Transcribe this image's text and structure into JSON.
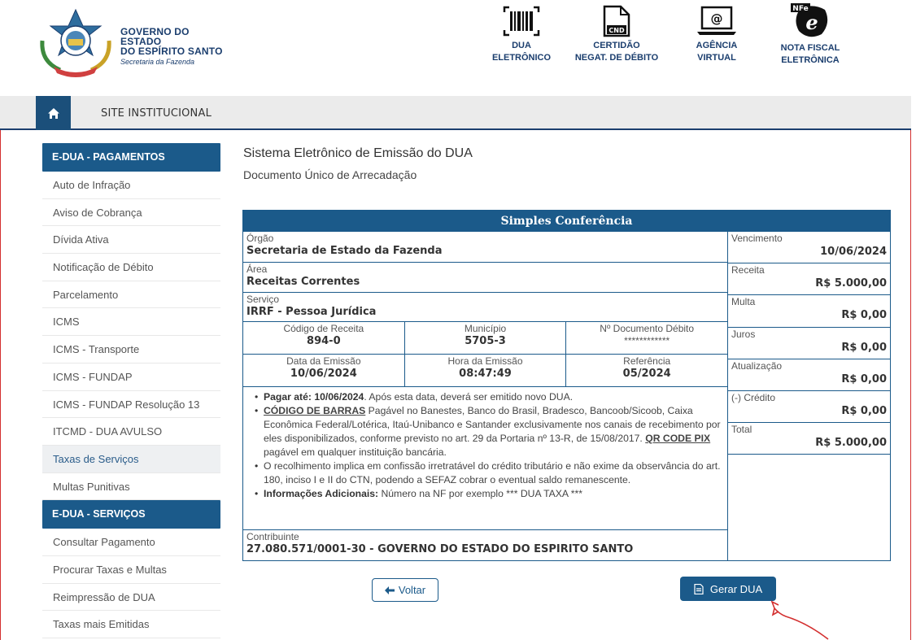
{
  "header": {
    "org_line1": "GOVERNO DO ESTADO",
    "org_line2": "DO ESPÍRITO SANTO",
    "org_line3": "Secretaria da Fazenda",
    "icons": [
      {
        "name": "barcode-icon",
        "line1": "DUA",
        "line2": "ELETRÔNICO"
      },
      {
        "name": "document-icon",
        "badge": "CND",
        "line1": "CERTIDÃO",
        "line2": "NEGAT. DE DÉBITO"
      },
      {
        "name": "laptop-at-icon",
        "line1": "AGÊNCIA",
        "line2": "VIRTUAL"
      },
      {
        "name": "nfe-icon",
        "badge": "NFe",
        "line1": "NOTA FISCAL",
        "line2": "ELETRÔNICA"
      }
    ]
  },
  "nav": {
    "home_icon": "home-icon",
    "link": "SITE INSTITUCIONAL"
  },
  "sidebar": {
    "section1": "E-DUA - PAGAMENTOS",
    "items1": [
      "Auto de Infração",
      "Aviso de Cobrança",
      "Dívida Ativa",
      "Notificação de Débito",
      "Parcelamento",
      "ICMS",
      "ICMS - Transporte",
      "ICMS - FUNDAP",
      "ICMS - FUNDAP Resolução 13",
      "ITCMD - DUA AVULSO",
      "Taxas de Serviços",
      "Multas Punitivas"
    ],
    "active_item": "Taxas de Serviços",
    "section2": "E-DUA - SERVIÇOS",
    "items2": [
      "Consultar Pagamento",
      "Procurar Taxas e Multas",
      "Reimpressão de DUA",
      "Taxas mais Emitidas"
    ]
  },
  "main": {
    "title": "Sistema Eletrônico de Emissão do DUA",
    "subtitle": "Documento Único de Arrecadação"
  },
  "conferencia": {
    "heading": "Simples Conferência",
    "orgao_label": "Órgão",
    "orgao_value": "Secretaria de Estado da Fazenda",
    "area_label": "Área",
    "area_value": "Receitas Correntes",
    "servico_label": "Serviço",
    "servico_value": "IRRF - Pessoa Jurídica",
    "codigo_label": "Código de Receita",
    "codigo_value": "894-0",
    "municipio_label": "Município",
    "municipio_value": "5705-3",
    "ndoc_label": "Nº Documento Débito",
    "ndoc_value": "************",
    "emissao_label": "Data da Emissão",
    "emissao_value": "10/06/2024",
    "hora_label": "Hora da Emissão",
    "hora_value": "08:47:49",
    "referencia_label": "Referência",
    "referencia_value": "05/2024",
    "note1_bold": "Pagar até: 10/06/2024",
    "note1_rest": ". Após esta data, deverá ser emitido novo DUA.",
    "note2_link": "CÓDIGO DE BARRAS",
    "note2_text": " Pagável no Banestes, Banco do Brasil, Bradesco, Bancoob/Sicoob, Caixa Econômica Federal/Lotérica, Itaú-Unibanco e Santander exclusivamente nos canais de recebimento por eles disponibilizados, conforme previsto no art. 29 da Portaria nº 13-R, de 15/08/2017. ",
    "note2_link2": "QR CODE PIX",
    "note2_text2": " pagável em qualquer instituição bancária.",
    "note3": "O recolhimento implica em confissão irretratável do crédito tributário e não exime da observância do art. 180, inciso I e II do CTN, podendo a SEFAZ cobrar o eventual saldo remanescente.",
    "note4_bold": "Informações Adicionais:",
    "note4_text": " Número na NF por exemplo *** DUA TAXA ***",
    "contribuinte_label": "Contribuinte",
    "contribuinte_value": "27.080.571/0001-30 - GOVERNO DO ESTADO DO ESPIRITO SANTO",
    "right": [
      {
        "label": "Vencimento",
        "value": "10/06/2024"
      },
      {
        "label": "Receita",
        "value": "R$ 5.000,00"
      },
      {
        "label": "Multa",
        "value": "R$ 0,00"
      },
      {
        "label": "Juros",
        "value": "R$ 0,00"
      },
      {
        "label": "Atualização",
        "value": "R$ 0,00"
      },
      {
        "label": "(-) Crédito",
        "value": "R$ 0,00"
      },
      {
        "label": "Total",
        "value": "R$ 5.000,00"
      }
    ]
  },
  "buttons": {
    "voltar": "Voltar",
    "gerar": "Gerar DUA"
  },
  "colors": {
    "primary": "#1b5a8a",
    "dark_navy": "#1b3e6e",
    "annotation_red": "#d32f2f"
  }
}
